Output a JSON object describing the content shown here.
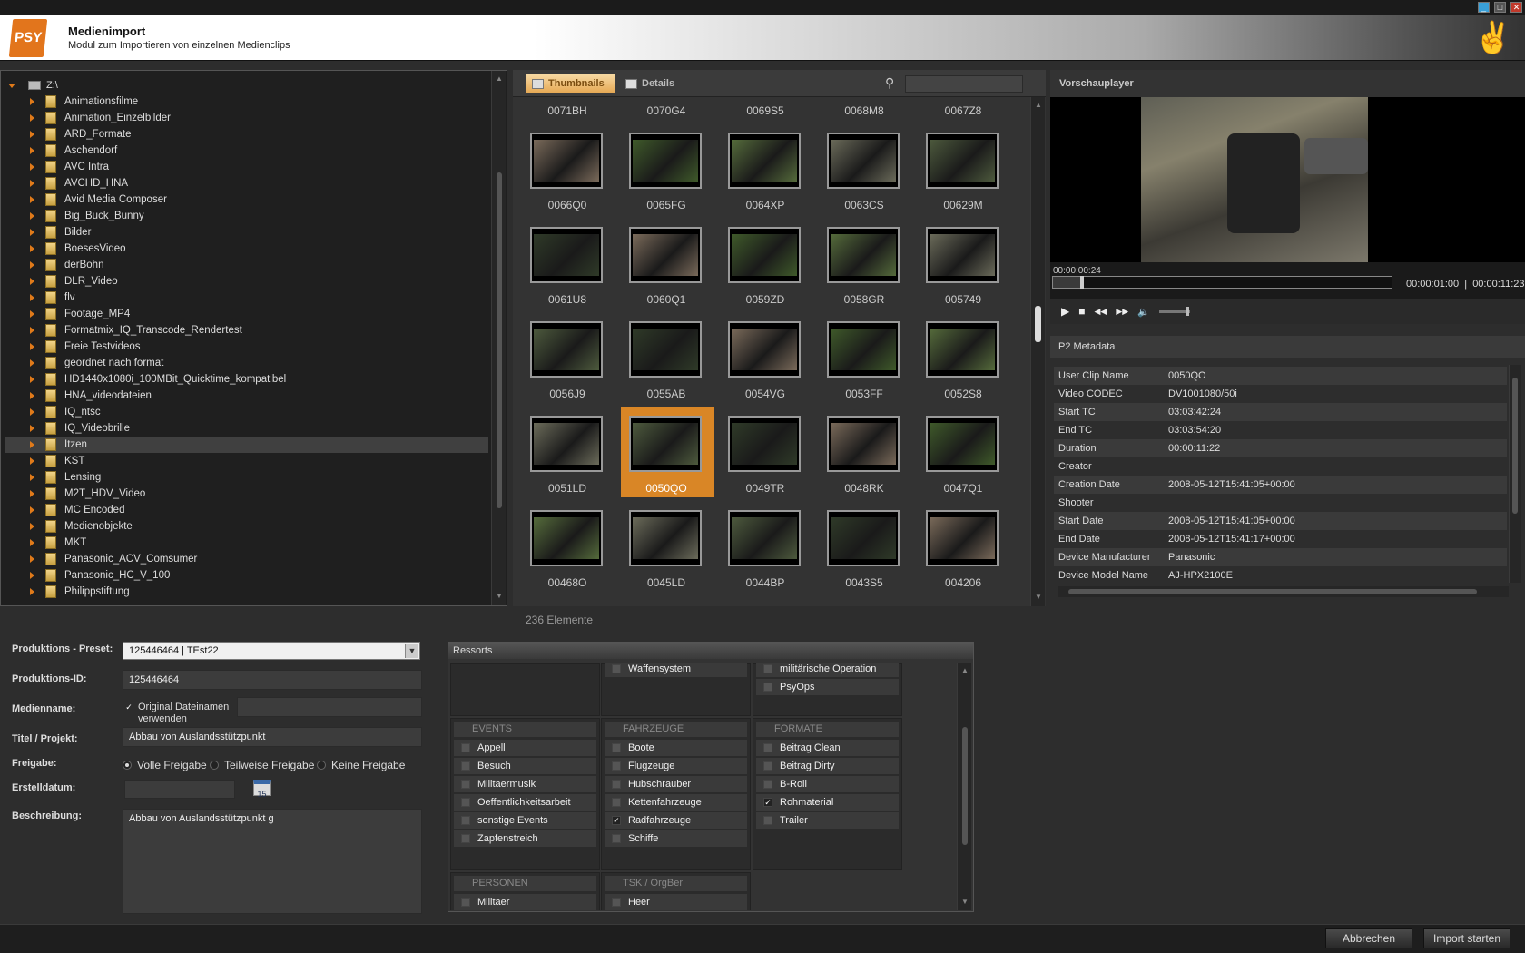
{
  "window": {
    "min": "_",
    "max": "□",
    "close": "✕"
  },
  "header": {
    "logo": "PSY",
    "title": "Medienimport",
    "subtitle": "Modul zum Importieren von einzelnen Medienclips",
    "emblem": "✌"
  },
  "tree": {
    "root": "Z:\\",
    "selected": "Itzen",
    "items": [
      "Animationsfilme",
      "Animation_Einzelbilder",
      "ARD_Formate",
      "Aschendorf",
      "AVC Intra",
      "AVCHD_HNA",
      "Avid Media Composer",
      "Big_Buck_Bunny",
      "Bilder",
      "BoesesVideo",
      "derBohn",
      "DLR_Video",
      "flv",
      "Footage_MP4",
      "Formatmix_IQ_Transcode_Rendertest",
      "Freie Testvideos",
      "geordnet nach format",
      "HD1440x1080i_100MBit_Quicktime_kompatibel",
      "HNA_videodateien",
      "IQ_ntsc",
      "IQ_Videobrille",
      "Itzen",
      "KST",
      "Lensing",
      "M2T_HDV_Video",
      "MC Encoded",
      "Medienobjekte",
      "MKT",
      "Panasonic_ACV_Comsumer",
      "Panasonic_HC_V_100",
      "Philippstiftung"
    ]
  },
  "thumbs": {
    "tab_thumbnails": "Thumbnails",
    "tab_details": "Details",
    "search_value": "",
    "selected": "0050QO",
    "count_label": "236 Elemente",
    "rows": [
      [
        "0071BH",
        "0070G4",
        "0069S5",
        "0068M8",
        "0067Z8"
      ],
      [
        "0066Q0",
        "0065FG",
        "0064XP",
        "0063CS",
        "00629M"
      ],
      [
        "0061U8",
        "0060Q1",
        "0059ZD",
        "0058GR",
        "005749"
      ],
      [
        "0056J9",
        "0055AB",
        "0054VG",
        "0053FF",
        "0052S8"
      ],
      [
        "0051LD",
        "0050QO",
        "0049TR",
        "0048RK",
        "0047Q1"
      ],
      [
        "00468O",
        "0045LD",
        "0044BP",
        "0043S5",
        "004206"
      ]
    ]
  },
  "player": {
    "title": "Vorschauplayer",
    "current_tc": "00:00:00:24",
    "range": "00:00:01:00  |  00:00:11:23",
    "progress": 0.08,
    "volume": 0.85,
    "btn_play": "▶",
    "btn_stop": "■",
    "btn_rew": "◀◀",
    "btn_ff": "▶▶",
    "btn_vol": "🔈"
  },
  "metadata": {
    "title": "P2 Metadata",
    "rows": [
      [
        "User Clip Name",
        "0050QO"
      ],
      [
        "Video CODEC",
        "DV1001080/50i"
      ],
      [
        "Start TC",
        "03:03:42:24"
      ],
      [
        "End TC",
        "03:03:54:20"
      ],
      [
        "Duration",
        "00:00:11:22"
      ],
      [
        "Creator",
        ""
      ],
      [
        "Creation Date",
        "2008-05-12T15:41:05+00:00"
      ],
      [
        "Shooter",
        ""
      ],
      [
        "Start Date",
        "2008-05-12T15:41:05+00:00"
      ],
      [
        "End Date",
        "2008-05-12T15:41:17+00:00"
      ],
      [
        "Device Manufacturer",
        "Panasonic"
      ],
      [
        "Device Model Name",
        "AJ-HPX2100E"
      ]
    ]
  },
  "form": {
    "preset_label": "Produktions - Preset:",
    "preset_value": "125446464 | TEst22",
    "id_label": "Produktions-ID:",
    "id_value": "125446464",
    "medienname_label": "Medienname:",
    "original_label_1": "Original Dateinamen",
    "original_label_2": "verwenden",
    "medienname_value": "",
    "titel_label": "Titel / Projekt:",
    "titel_value": "Abbau von Auslandsstützpunkt",
    "freigabe_label": "Freigabe:",
    "radio_full": "Volle Freigabe",
    "radio_partial": "Teilweise Freigabe",
    "radio_none": "Keine Freigabe",
    "datum_label": "Erstelldatum:",
    "datum_value": "",
    "cal_day": "15",
    "beschreibung_label": "Beschreibung:",
    "beschreibung_value": "Abbau von Auslandsstützpunkt g"
  },
  "ressorts": {
    "title": "Ressorts",
    "top": {
      "col2": "Waffensystem",
      "col3a": "militärische Operation",
      "col3b": "PsyOps"
    },
    "events": {
      "head": "EVENTS",
      "items": [
        "Appell",
        "Besuch",
        "Militaermusik",
        "Oeffentlichkeitsarbeit",
        "sonstige Events",
        "Zapfenstreich"
      ]
    },
    "fahrzeuge": {
      "head": "FAHRZEUGE",
      "items": [
        "Boote",
        "Flugzeuge",
        "Hubschrauber",
        "Kettenfahrzeuge",
        "Radfahrzeuge",
        "Schiffe"
      ]
    },
    "formate": {
      "head": "FORMATE",
      "items": [
        "Beitrag Clean",
        "Beitrag Dirty",
        "B-Roll",
        "Rohmaterial",
        "Trailer"
      ]
    },
    "personen": {
      "head": "PERSONEN",
      "items": [
        "Militaer"
      ]
    },
    "tsk": {
      "head": "TSK / OrgBer",
      "items": [
        "Heer"
      ]
    },
    "check": "✓"
  },
  "buttons": {
    "cancel": "Abbrechen",
    "start": "Import starten"
  },
  "colors": {
    "accent": "#d98626",
    "bg": "#2d2d2d"
  }
}
